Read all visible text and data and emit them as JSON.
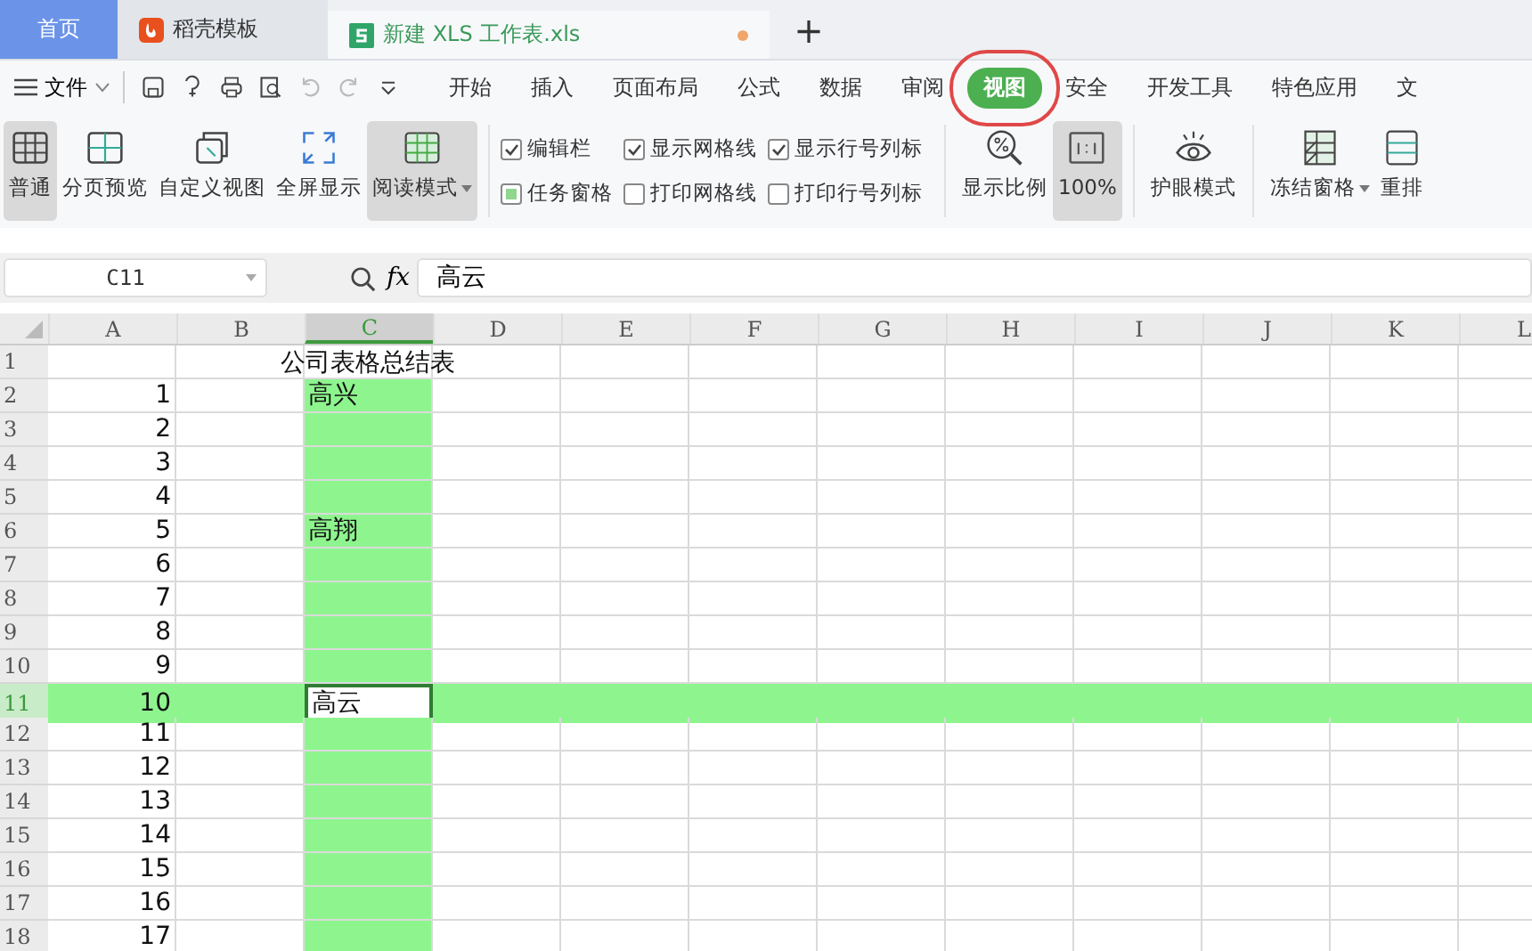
{
  "tabs": [
    {
      "label": "首页",
      "kind": "home",
      "selected": false
    },
    {
      "label": "稻壳模板",
      "kind": "docer",
      "selected": false
    },
    {
      "label": "新建 XLS 工作表.xls",
      "kind": "sheet",
      "selected": true
    }
  ],
  "new_tab": "+",
  "menu": {
    "file": "文件",
    "items": [
      {
        "label": "开始",
        "selected": false
      },
      {
        "label": "插入",
        "selected": false
      },
      {
        "label": "页面布局",
        "selected": false
      },
      {
        "label": "公式",
        "selected": false
      },
      {
        "label": "数据",
        "selected": false
      },
      {
        "label": "审阅",
        "selected": false
      },
      {
        "label": "视图",
        "selected": true
      },
      {
        "label": "安全",
        "selected": false
      },
      {
        "label": "开发工具",
        "selected": false
      },
      {
        "label": "特色应用",
        "selected": false
      },
      {
        "label": "文",
        "selected": false
      }
    ]
  },
  "ribbon": {
    "left": [
      {
        "label": "普通",
        "kind": "grid",
        "selected": true,
        "dropdown": false
      },
      {
        "label": "分页预览",
        "kind": "split",
        "selected": false,
        "dropdown": false
      },
      {
        "label": "自定义视图",
        "kind": "window",
        "selected": false,
        "dropdown": false
      },
      {
        "label": "全屏显示",
        "kind": "expand",
        "selected": false,
        "dropdown": false
      },
      {
        "label": "阅读模式",
        "kind": "read",
        "selected": true,
        "dropdown": true
      }
    ],
    "checkboxes": [
      [
        {
          "label": "编辑栏",
          "checked": true,
          "kind": "tick"
        },
        {
          "label": "任务窗格",
          "checked": true,
          "kind": "fill"
        }
      ],
      [
        {
          "label": "显示网格线",
          "checked": true,
          "kind": "tick"
        },
        {
          "label": "打印网格线",
          "checked": false,
          "kind": "tick"
        }
      ],
      [
        {
          "label": "显示行号列标",
          "checked": true,
          "kind": "tick"
        },
        {
          "label": "打印行号列标",
          "checked": false,
          "kind": "tick"
        }
      ]
    ],
    "right": [
      {
        "label": "显示比例",
        "kind": "zoom",
        "selected": false,
        "dropdown": false
      },
      {
        "label": "100%",
        "kind": "actual",
        "selected": true,
        "dropdown": false
      },
      {
        "label": "护眼模式",
        "kind": "eye",
        "selected": false,
        "dropdown": false
      },
      {
        "label": "冻结窗格",
        "kind": "freeze",
        "selected": false,
        "dropdown": true
      },
      {
        "label": "重排",
        "kind": "arrange",
        "selected": false,
        "dropdown": false
      }
    ]
  },
  "name_box": "C11",
  "formula": "高云",
  "fx": "fx",
  "columns": [
    {
      "label": "A",
      "selected": false
    },
    {
      "label": "B",
      "selected": false
    },
    {
      "label": "C",
      "selected": true
    },
    {
      "label": "D",
      "selected": false
    },
    {
      "label": "E",
      "selected": false
    },
    {
      "label": "F",
      "selected": false
    },
    {
      "label": "G",
      "selected": false
    },
    {
      "label": "H",
      "selected": false
    },
    {
      "label": "I",
      "selected": false
    },
    {
      "label": "J",
      "selected": false
    },
    {
      "label": "K",
      "selected": false
    },
    {
      "label": "L",
      "selected": false
    }
  ],
  "rows": [
    {
      "number": "1",
      "selected": false,
      "highlight": false,
      "title": "公司表格总结表"
    },
    {
      "number": "2",
      "selected": false,
      "highlight": true,
      "a": "1",
      "c": "高兴"
    },
    {
      "number": "3",
      "selected": false,
      "highlight": true,
      "a": "2"
    },
    {
      "number": "4",
      "selected": false,
      "highlight": true,
      "a": "3"
    },
    {
      "number": "5",
      "selected": false,
      "highlight": true,
      "a": "4"
    },
    {
      "number": "6",
      "selected": false,
      "highlight": true,
      "a": "5",
      "c": "高翔"
    },
    {
      "number": "7",
      "selected": false,
      "highlight": true,
      "a": "6"
    },
    {
      "number": "8",
      "selected": false,
      "highlight": true,
      "a": "7"
    },
    {
      "number": "9",
      "selected": false,
      "highlight": true,
      "a": "8"
    },
    {
      "number": "10",
      "selected": false,
      "highlight": true,
      "a": "9"
    },
    {
      "number": "11",
      "selected": true,
      "a": "10",
      "c": "高云"
    },
    {
      "number": "12",
      "selected": false,
      "highlight": true,
      "a": "11"
    },
    {
      "number": "13",
      "selected": false,
      "highlight": true,
      "a": "12"
    },
    {
      "number": "14",
      "selected": false,
      "highlight": true,
      "a": "13"
    },
    {
      "number": "15",
      "selected": false,
      "highlight": true,
      "a": "14"
    },
    {
      "number": "16",
      "selected": false,
      "highlight": true,
      "a": "15"
    },
    {
      "number": "17",
      "selected": false,
      "highlight": true,
      "a": "16"
    },
    {
      "number": "18",
      "selected": false,
      "highlight": true,
      "a": "17"
    }
  ]
}
